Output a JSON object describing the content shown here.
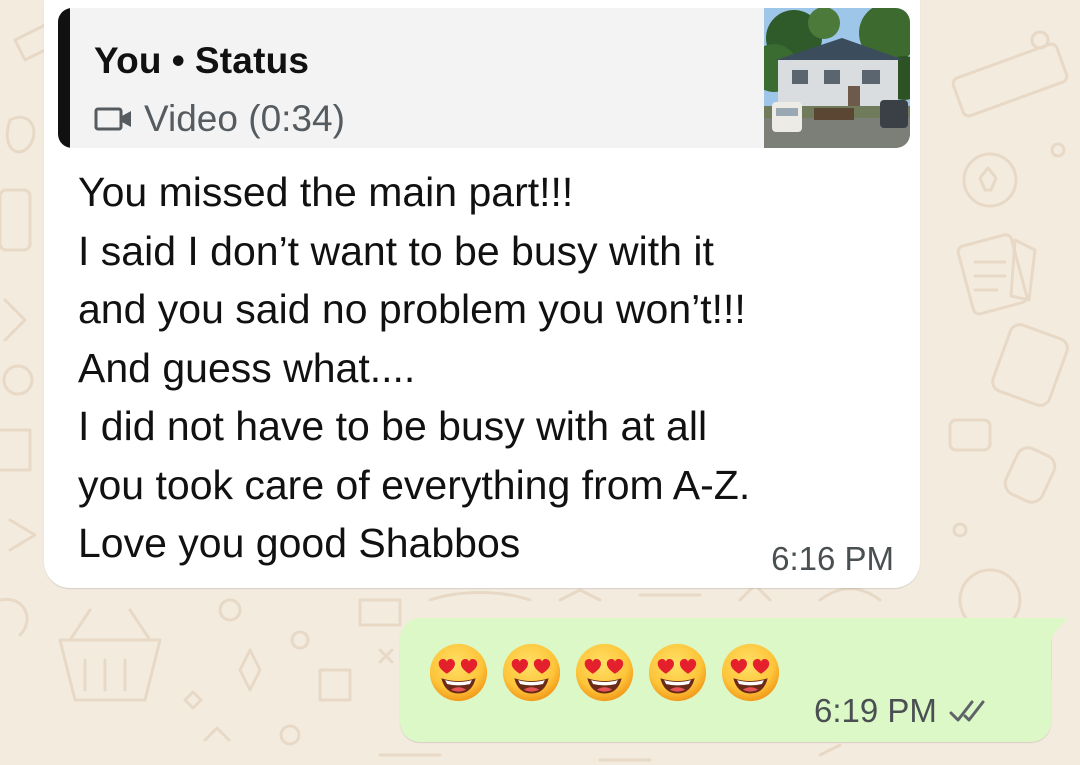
{
  "chat": {
    "incoming": {
      "quote": {
        "author": "You",
        "separator": "•",
        "source": "Status",
        "media_label": "Video (0:34)",
        "media_icon": "video-icon"
      },
      "lines": [
        "You missed the main part!!!",
        "I said I don’t want to be busy with it",
        "and you said no problem you won’t!!!",
        "And guess what....",
        "I did not have to be busy with at all",
        "you took care of everything from A-Z.",
        "Love you good Shabbos"
      ],
      "time": "6:16 PM"
    },
    "outgoing": {
      "emoji_count": 5,
      "emoji_name": "smiling-face-with-heart-eyes",
      "time": "6:19 PM",
      "status_icon": "double-check-icon"
    }
  },
  "colors": {
    "wallpaper": "#f4ebdf",
    "incoming_bubble": "#ffffff",
    "outgoing_bubble": "#dcf8c6",
    "quote_bar": "#111111"
  }
}
